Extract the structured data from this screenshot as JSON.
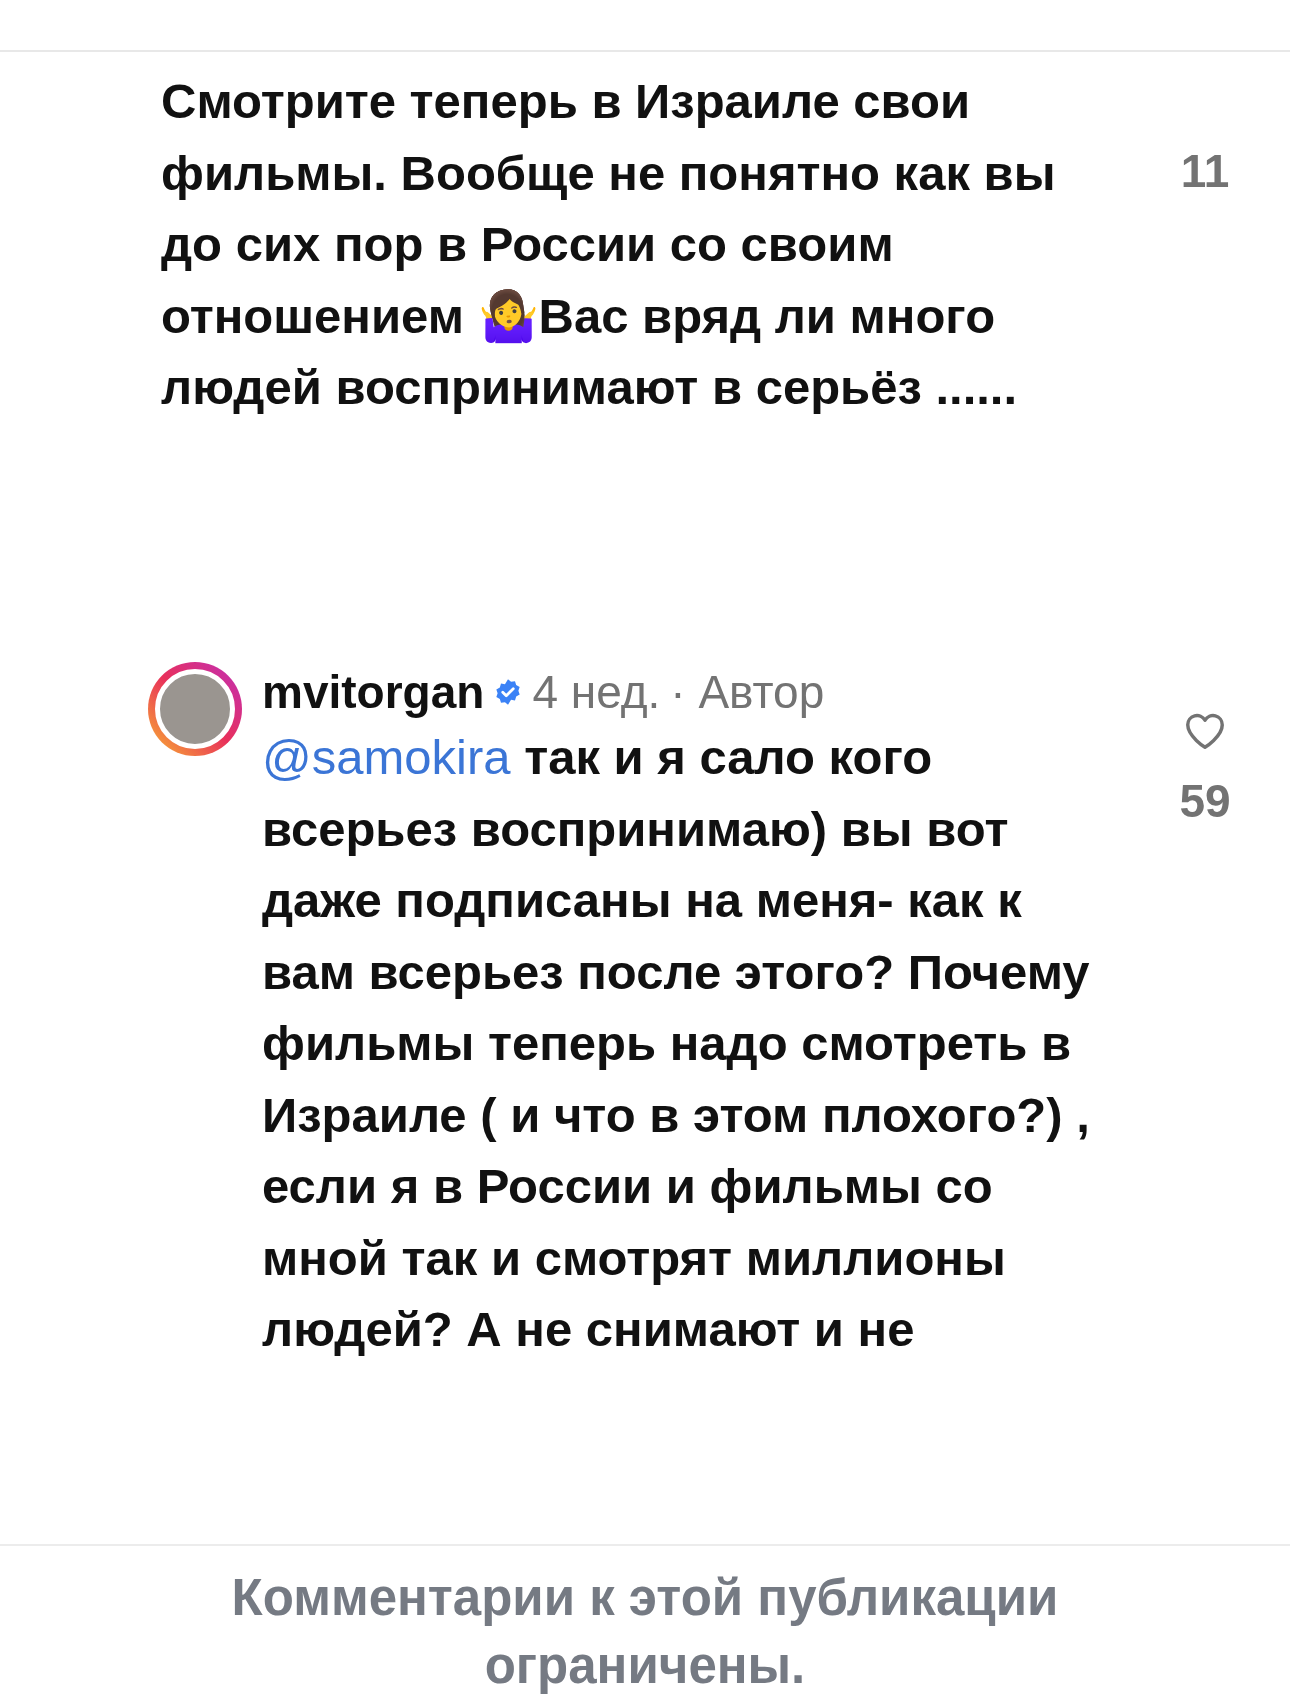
{
  "comments": [
    {
      "kind": "plain",
      "text": "Смотрите теперь в Израиле свои фильмы. Вообще не понятно как вы до сих пор в России со своим отношением 🤷‍♀️Вас вряд ли много людей воспринимают в серьёз ......",
      "likes": "11"
    },
    {
      "kind": "author",
      "username": "mvitorgan",
      "verified": true,
      "time": "4 нед.",
      "badge": "· Автор",
      "mention": "@samokira",
      "text": "так и я сало кого всерьез воспринимаю) вы вот даже подписаны на меня- как к вам всерьез после этого? Почему фильмы теперь надо смотреть в Израиле ( и что в этом плохого?) , если я в России и фильмы со мной так и смотрят миллионы людей? А не снимают и не",
      "likes": "59"
    }
  ],
  "footer": {
    "notice": "Комментарии к этой публикации ограничены."
  }
}
